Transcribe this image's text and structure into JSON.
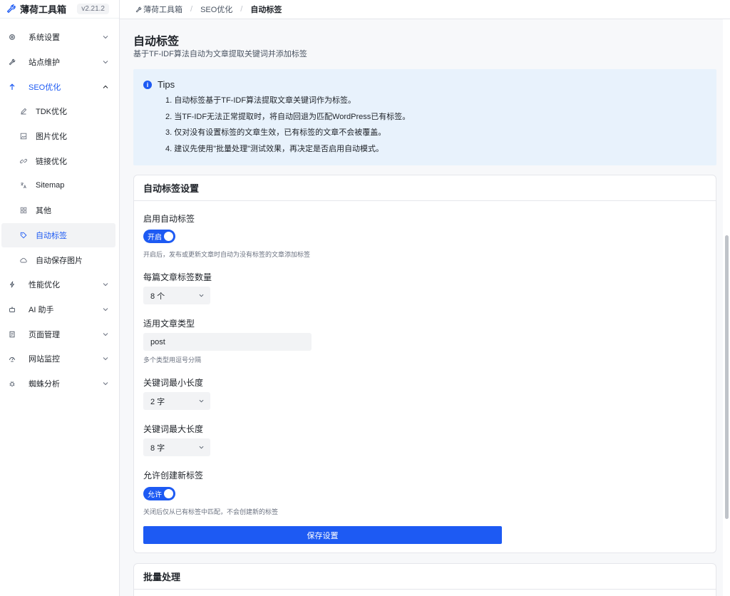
{
  "app": {
    "name": "薄荷工具箱",
    "version": "v2.21.2"
  },
  "breadcrumb": {
    "home": "薄荷工具箱",
    "section": "SEO优化",
    "current": "自动标签"
  },
  "sidebar": {
    "items": [
      {
        "label": "系统设置",
        "icon": "gear-icon"
      },
      {
        "label": "站点维护",
        "icon": "wrench-icon"
      },
      {
        "label": "SEO优化",
        "icon": "arrow-up-icon",
        "expanded": true
      },
      {
        "label": "性能优化",
        "icon": "bolt-icon"
      },
      {
        "label": "AI 助手",
        "icon": "robot-icon"
      },
      {
        "label": "页面管理",
        "icon": "document-icon"
      },
      {
        "label": "网站监控",
        "icon": "monitor-icon"
      },
      {
        "label": "蜘蛛分析",
        "icon": "bug-icon"
      }
    ],
    "seo_children": [
      {
        "label": "TDK优化",
        "icon": "pen-icon"
      },
      {
        "label": "图片优化",
        "icon": "image-icon"
      },
      {
        "label": "链接优化",
        "icon": "link-icon"
      },
      {
        "label": "Sitemap",
        "icon": "translate-icon"
      },
      {
        "label": "其他",
        "icon": "grid-icon"
      },
      {
        "label": "自动标签",
        "icon": "tag-icon",
        "selected": true
      },
      {
        "label": "自动保存图片",
        "icon": "cloud-icon"
      }
    ]
  },
  "page": {
    "title": "自动标签",
    "description": "基于TF-IDF算法自动为文章提取关键词并添加标签"
  },
  "tips": {
    "title": "Tips",
    "items": [
      "1. 自动标签基于TF-IDF算法提取文章关键词作为标签。",
      "2. 当TF-IDF无法正常提取时，将自动回退为匹配WordPress已有标签。",
      "3. 仅对没有设置标签的文章生效，已有标签的文章不会被覆盖。",
      "4. 建议先使用\"批量处理\"测试效果，再决定是否启用自动模式。"
    ]
  },
  "settings": {
    "title": "自动标签设置",
    "enable_label": "启用自动标签",
    "enable_switch": "开启",
    "enable_hint": "开启后，发布或更新文章时自动为没有标签的文章添加标签",
    "count_label": "每篇文章标签数量",
    "count_value": "8 个",
    "post_type_label": "适用文章类型",
    "post_type_value": "post",
    "post_type_hint": "多个类型用逗号分隔",
    "min_len_label": "关键词最小长度",
    "min_len_value": "2 字",
    "max_len_label": "关键词最大长度",
    "max_len_value": "8 字",
    "allow_new_label": "允许创建新标签",
    "allow_new_switch": "允许",
    "allow_new_hint": "关闭后仅从已有标签中匹配，不会创建新的标签",
    "save_label": "保存设置"
  },
  "batch": {
    "title": "批量处理"
  },
  "colors": {
    "accent": "#1d5af3",
    "tips_bg": "#e8f2fc",
    "page_bg": "#f7f8fa"
  }
}
